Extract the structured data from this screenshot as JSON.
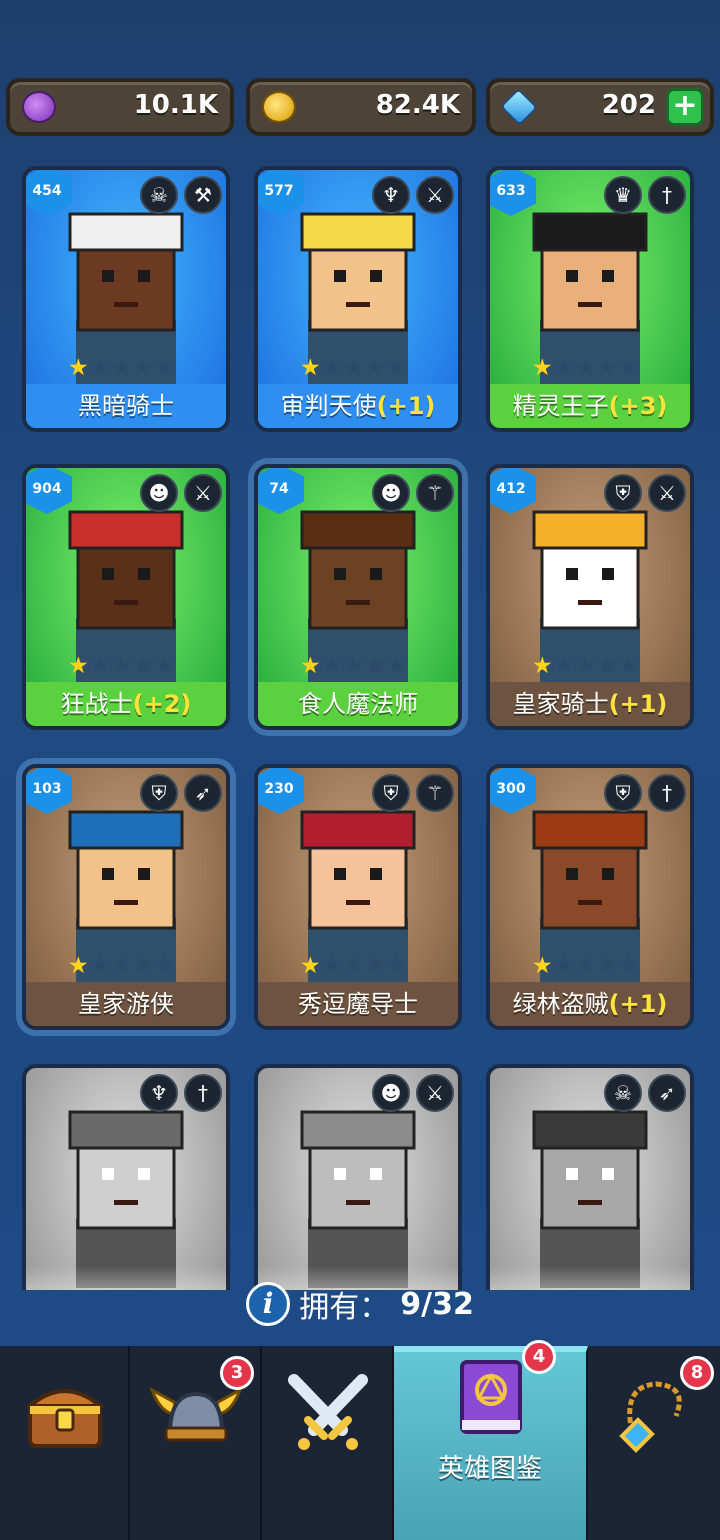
{
  "currency": {
    "purple": {
      "value": "10.1K",
      "icon": "purple-coin-icon",
      "color": "#9b4fd6"
    },
    "gold": {
      "value": "82.4K",
      "icon": "gold-coin-icon",
      "color": "#f5c400"
    },
    "gems": {
      "value": "202",
      "icon": "gem-icon",
      "color": "#3fb4f5",
      "plus_label": "+"
    }
  },
  "heroes": [
    {
      "name": "黑暗骑士",
      "bonus": "",
      "level": "454",
      "stars": 1,
      "rarity": "blue",
      "race_icon": "demon-skull-icon",
      "weapon_icon": "hammer-icon"
    },
    {
      "name": "审判天使",
      "bonus": "(+1)",
      "level": "577",
      "stars": 1,
      "rarity": "blue",
      "race_icon": "winged-angel-icon",
      "weapon_icon": "sword-icon"
    },
    {
      "name": "精灵王子",
      "bonus": "(+3)",
      "level": "633",
      "stars": 1,
      "rarity": "green",
      "race_icon": "elf-icon",
      "weapon_icon": "dagger-icon"
    },
    {
      "name": "狂战士",
      "bonus": "(+2)",
      "level": "904",
      "stars": 1,
      "rarity": "green",
      "race_icon": "orc-icon",
      "weapon_icon": "sword-icon"
    },
    {
      "name": "食人魔法师",
      "bonus": "",
      "level": "74",
      "stars": 1,
      "rarity": "green",
      "race_icon": "orc-icon",
      "weapon_icon": "staff-icon"
    },
    {
      "name": "皇家骑士",
      "bonus": "(+1)",
      "level": "412",
      "stars": 1,
      "rarity": "brown",
      "race_icon": "knight-helmet-icon",
      "weapon_icon": "sword-icon"
    },
    {
      "name": "皇家游侠",
      "bonus": "",
      "level": "103",
      "stars": 1,
      "rarity": "brown",
      "race_icon": "knight-helmet-icon",
      "weapon_icon": "bow-icon"
    },
    {
      "name": "秀逗魔导士",
      "bonus": "",
      "level": "230",
      "stars": 1,
      "rarity": "brown",
      "race_icon": "knight-helmet-icon",
      "weapon_icon": "staff-icon"
    },
    {
      "name": "绿林盗贼",
      "bonus": "(+1)",
      "level": "300",
      "stars": 1,
      "rarity": "brown",
      "race_icon": "knight-helmet-icon",
      "weapon_icon": "dagger-icon"
    },
    {
      "name": "",
      "bonus": "",
      "level": "",
      "stars": 0,
      "rarity": "gray",
      "race_icon": "winged-angel-icon",
      "weapon_icon": "dagger-icon"
    },
    {
      "name": "",
      "bonus": "",
      "level": "",
      "stars": 0,
      "rarity": "gray",
      "race_icon": "orc-icon",
      "weapon_icon": "sword-icon"
    },
    {
      "name": "",
      "bonus": "",
      "level": "",
      "stars": 0,
      "rarity": "gray",
      "race_icon": "demon-skull-icon",
      "weapon_icon": "bow-icon"
    }
  ],
  "owned": {
    "label": "拥有：",
    "count": "9/32"
  },
  "nav": {
    "items": [
      {
        "id": "chest",
        "icon": "treasure-chest-icon",
        "badge": "",
        "label": ""
      },
      {
        "id": "heroes",
        "icon": "viking-helmet-icon",
        "badge": "3",
        "label": ""
      },
      {
        "id": "battle",
        "icon": "crossed-swords-icon",
        "badge": "",
        "label": ""
      },
      {
        "id": "codex",
        "icon": "spellbook-icon",
        "badge": "4",
        "label": "英雄图鉴",
        "active": true
      },
      {
        "id": "equipment",
        "icon": "amulet-icon",
        "badge": "8",
        "label": ""
      }
    ]
  }
}
